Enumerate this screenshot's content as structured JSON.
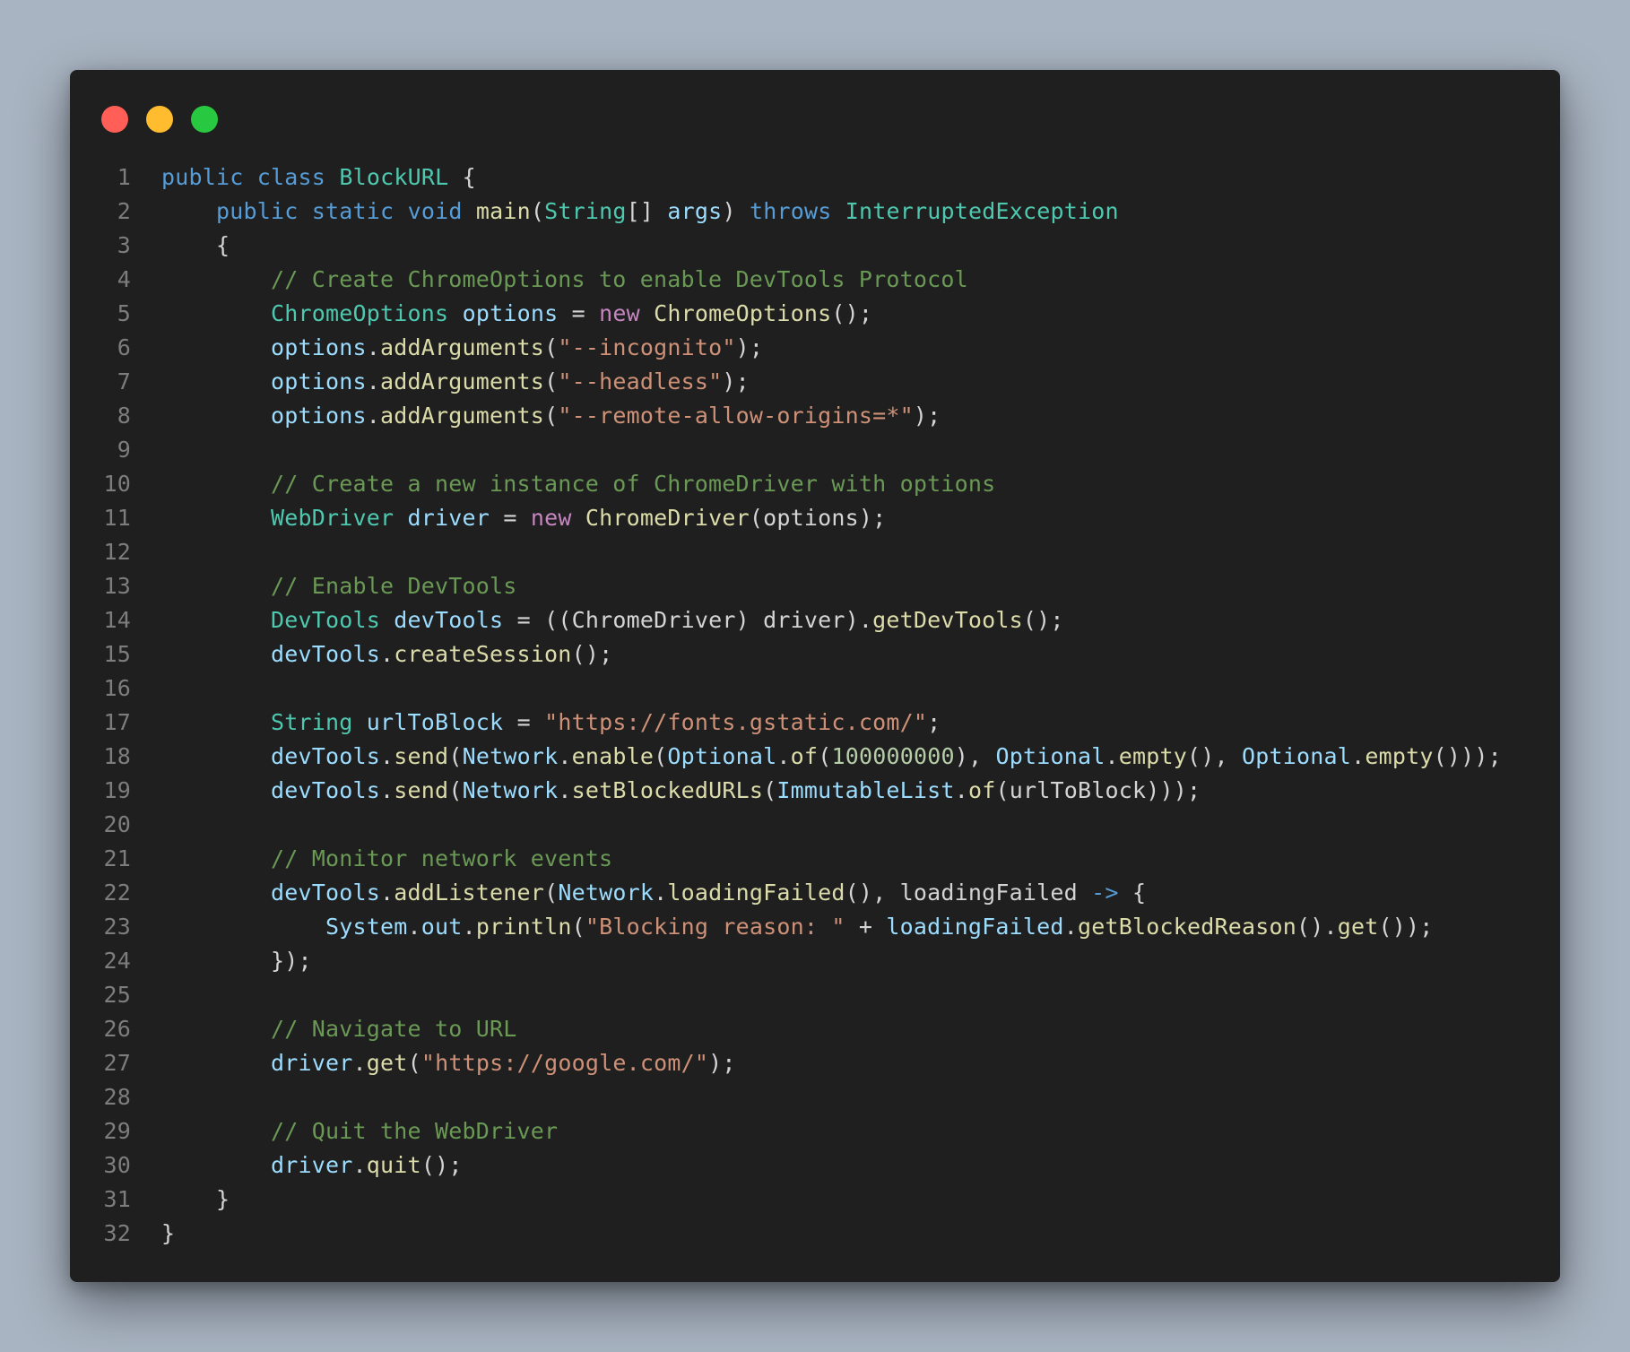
{
  "window": {
    "controls": [
      "close",
      "minimize",
      "zoom"
    ],
    "colors": {
      "background": "#1f1f1f",
      "close": "#ff5f57",
      "minimize": "#febc2e",
      "zoom": "#28c840"
    }
  },
  "code": {
    "language": "java",
    "lines": [
      {
        "n": "1",
        "tokens": [
          [
            "kw",
            "public"
          ],
          [
            "pl",
            " "
          ],
          [
            "kw",
            "class"
          ],
          [
            "pl",
            " "
          ],
          [
            "ty",
            "BlockURL"
          ],
          [
            "pl",
            " {"
          ]
        ]
      },
      {
        "n": "2",
        "tokens": [
          [
            "pl",
            "    "
          ],
          [
            "kw",
            "public"
          ],
          [
            "pl",
            " "
          ],
          [
            "kw",
            "static"
          ],
          [
            "pl",
            " "
          ],
          [
            "kw",
            "void"
          ],
          [
            "pl",
            " "
          ],
          [
            "fn",
            "main"
          ],
          [
            "pl",
            "("
          ],
          [
            "ty",
            "String"
          ],
          [
            "pl",
            "[] "
          ],
          [
            "var",
            "args"
          ],
          [
            "pl",
            ") "
          ],
          [
            "kw",
            "throws"
          ],
          [
            "pl",
            " "
          ],
          [
            "ty",
            "InterruptedException"
          ]
        ]
      },
      {
        "n": "3",
        "tokens": [
          [
            "pl",
            "    {"
          ]
        ]
      },
      {
        "n": "4",
        "tokens": [
          [
            "pl",
            "        "
          ],
          [
            "cm",
            "// Create ChromeOptions to enable DevTools Protocol"
          ]
        ]
      },
      {
        "n": "5",
        "tokens": [
          [
            "pl",
            "        "
          ],
          [
            "ty",
            "ChromeOptions"
          ],
          [
            "pl",
            " "
          ],
          [
            "var",
            "options"
          ],
          [
            "pl",
            " = "
          ],
          [
            "kw2",
            "new"
          ],
          [
            "pl",
            " "
          ],
          [
            "fn",
            "ChromeOptions"
          ],
          [
            "pl",
            "();"
          ]
        ]
      },
      {
        "n": "6",
        "tokens": [
          [
            "pl",
            "        "
          ],
          [
            "var",
            "options"
          ],
          [
            "pl",
            "."
          ],
          [
            "fn",
            "addArguments"
          ],
          [
            "pl",
            "("
          ],
          [
            "str",
            "\"--incognito\""
          ],
          [
            "pl",
            ");"
          ]
        ]
      },
      {
        "n": "7",
        "tokens": [
          [
            "pl",
            "        "
          ],
          [
            "var",
            "options"
          ],
          [
            "pl",
            "."
          ],
          [
            "fn",
            "addArguments"
          ],
          [
            "pl",
            "("
          ],
          [
            "str",
            "\"--headless\""
          ],
          [
            "pl",
            ");"
          ]
        ]
      },
      {
        "n": "8",
        "tokens": [
          [
            "pl",
            "        "
          ],
          [
            "var",
            "options"
          ],
          [
            "pl",
            "."
          ],
          [
            "fn",
            "addArguments"
          ],
          [
            "pl",
            "("
          ],
          [
            "str",
            "\"--remote-allow-origins=*\""
          ],
          [
            "pl",
            ");"
          ]
        ]
      },
      {
        "n": "9",
        "tokens": []
      },
      {
        "n": "10",
        "tokens": [
          [
            "pl",
            "        "
          ],
          [
            "cm",
            "// Create a new instance of ChromeDriver with options"
          ]
        ]
      },
      {
        "n": "11",
        "tokens": [
          [
            "pl",
            "        "
          ],
          [
            "ty",
            "WebDriver"
          ],
          [
            "pl",
            " "
          ],
          [
            "var",
            "driver"
          ],
          [
            "pl",
            " = "
          ],
          [
            "kw2",
            "new"
          ],
          [
            "pl",
            " "
          ],
          [
            "fn",
            "ChromeDriver"
          ],
          [
            "pl",
            "(options);"
          ]
        ]
      },
      {
        "n": "12",
        "tokens": []
      },
      {
        "n": "13",
        "tokens": [
          [
            "pl",
            "        "
          ],
          [
            "cm",
            "// Enable DevTools"
          ]
        ]
      },
      {
        "n": "14",
        "tokens": [
          [
            "pl",
            "        "
          ],
          [
            "ty",
            "DevTools"
          ],
          [
            "pl",
            " "
          ],
          [
            "var",
            "devTools"
          ],
          [
            "pl",
            " = ((ChromeDriver) driver)."
          ],
          [
            "fn",
            "getDevTools"
          ],
          [
            "pl",
            "();"
          ]
        ]
      },
      {
        "n": "15",
        "tokens": [
          [
            "pl",
            "        "
          ],
          [
            "var",
            "devTools"
          ],
          [
            "pl",
            "."
          ],
          [
            "fn",
            "createSession"
          ],
          [
            "pl",
            "();"
          ]
        ]
      },
      {
        "n": "16",
        "tokens": []
      },
      {
        "n": "17",
        "tokens": [
          [
            "pl",
            "        "
          ],
          [
            "ty",
            "String"
          ],
          [
            "pl",
            " "
          ],
          [
            "var",
            "urlToBlock"
          ],
          [
            "pl",
            " = "
          ],
          [
            "str",
            "\"https://fonts.gstatic.com/\""
          ],
          [
            "pl",
            ";"
          ]
        ]
      },
      {
        "n": "18",
        "tokens": [
          [
            "pl",
            "        "
          ],
          [
            "var",
            "devTools"
          ],
          [
            "pl",
            "."
          ],
          [
            "fn",
            "send"
          ],
          [
            "pl",
            "("
          ],
          [
            "var",
            "Network"
          ],
          [
            "pl",
            "."
          ],
          [
            "fn",
            "enable"
          ],
          [
            "pl",
            "("
          ],
          [
            "var",
            "Optional"
          ],
          [
            "pl",
            "."
          ],
          [
            "fn",
            "of"
          ],
          [
            "pl",
            "("
          ],
          [
            "num",
            "100000000"
          ],
          [
            "pl",
            "), "
          ],
          [
            "var",
            "Optional"
          ],
          [
            "pl",
            "."
          ],
          [
            "fn",
            "empty"
          ],
          [
            "pl",
            "(), "
          ],
          [
            "var",
            "Optional"
          ],
          [
            "pl",
            "."
          ],
          [
            "fn",
            "empty"
          ],
          [
            "pl",
            "()));"
          ]
        ]
      },
      {
        "n": "19",
        "tokens": [
          [
            "pl",
            "        "
          ],
          [
            "var",
            "devTools"
          ],
          [
            "pl",
            "."
          ],
          [
            "fn",
            "send"
          ],
          [
            "pl",
            "("
          ],
          [
            "var",
            "Network"
          ],
          [
            "pl",
            "."
          ],
          [
            "fn",
            "setBlockedURLs"
          ],
          [
            "pl",
            "("
          ],
          [
            "var",
            "ImmutableList"
          ],
          [
            "pl",
            "."
          ],
          [
            "fn",
            "of"
          ],
          [
            "pl",
            "(urlToBlock)));"
          ]
        ]
      },
      {
        "n": "20",
        "tokens": []
      },
      {
        "n": "21",
        "tokens": [
          [
            "pl",
            "        "
          ],
          [
            "cm",
            "// Monitor network events"
          ]
        ]
      },
      {
        "n": "22",
        "tokens": [
          [
            "pl",
            "        "
          ],
          [
            "var",
            "devTools"
          ],
          [
            "pl",
            "."
          ],
          [
            "fn",
            "addListener"
          ],
          [
            "pl",
            "("
          ],
          [
            "var",
            "Network"
          ],
          [
            "pl",
            "."
          ],
          [
            "fn",
            "loadingFailed"
          ],
          [
            "pl",
            "(), loadingFailed "
          ],
          [
            "kw",
            "->"
          ],
          [
            "pl",
            " {"
          ]
        ]
      },
      {
        "n": "23",
        "tokens": [
          [
            "pl",
            "            "
          ],
          [
            "var",
            "System"
          ],
          [
            "pl",
            "."
          ],
          [
            "var",
            "out"
          ],
          [
            "pl",
            "."
          ],
          [
            "fn",
            "println"
          ],
          [
            "pl",
            "("
          ],
          [
            "str",
            "\"Blocking reason: \""
          ],
          [
            "pl",
            " + "
          ],
          [
            "var",
            "loadingFailed"
          ],
          [
            "pl",
            "."
          ],
          [
            "fn",
            "getBlockedReason"
          ],
          [
            "pl",
            "()."
          ],
          [
            "fn",
            "get"
          ],
          [
            "pl",
            "());"
          ]
        ]
      },
      {
        "n": "24",
        "tokens": [
          [
            "pl",
            "        });"
          ]
        ]
      },
      {
        "n": "25",
        "tokens": []
      },
      {
        "n": "26",
        "tokens": [
          [
            "pl",
            "        "
          ],
          [
            "cm",
            "// Navigate to URL"
          ]
        ]
      },
      {
        "n": "27",
        "tokens": [
          [
            "pl",
            "        "
          ],
          [
            "var",
            "driver"
          ],
          [
            "pl",
            "."
          ],
          [
            "fn",
            "get"
          ],
          [
            "pl",
            "("
          ],
          [
            "str",
            "\"https://google.com/\""
          ],
          [
            "pl",
            ");"
          ]
        ]
      },
      {
        "n": "28",
        "tokens": []
      },
      {
        "n": "29",
        "tokens": [
          [
            "pl",
            "        "
          ],
          [
            "cm",
            "// Quit the WebDriver"
          ]
        ]
      },
      {
        "n": "30",
        "tokens": [
          [
            "pl",
            "        "
          ],
          [
            "var",
            "driver"
          ],
          [
            "pl",
            "."
          ],
          [
            "fn",
            "quit"
          ],
          [
            "pl",
            "();"
          ]
        ]
      },
      {
        "n": "31",
        "tokens": [
          [
            "pl",
            "    }"
          ]
        ]
      },
      {
        "n": "32",
        "tokens": [
          [
            "pl",
            "}"
          ]
        ]
      }
    ]
  }
}
